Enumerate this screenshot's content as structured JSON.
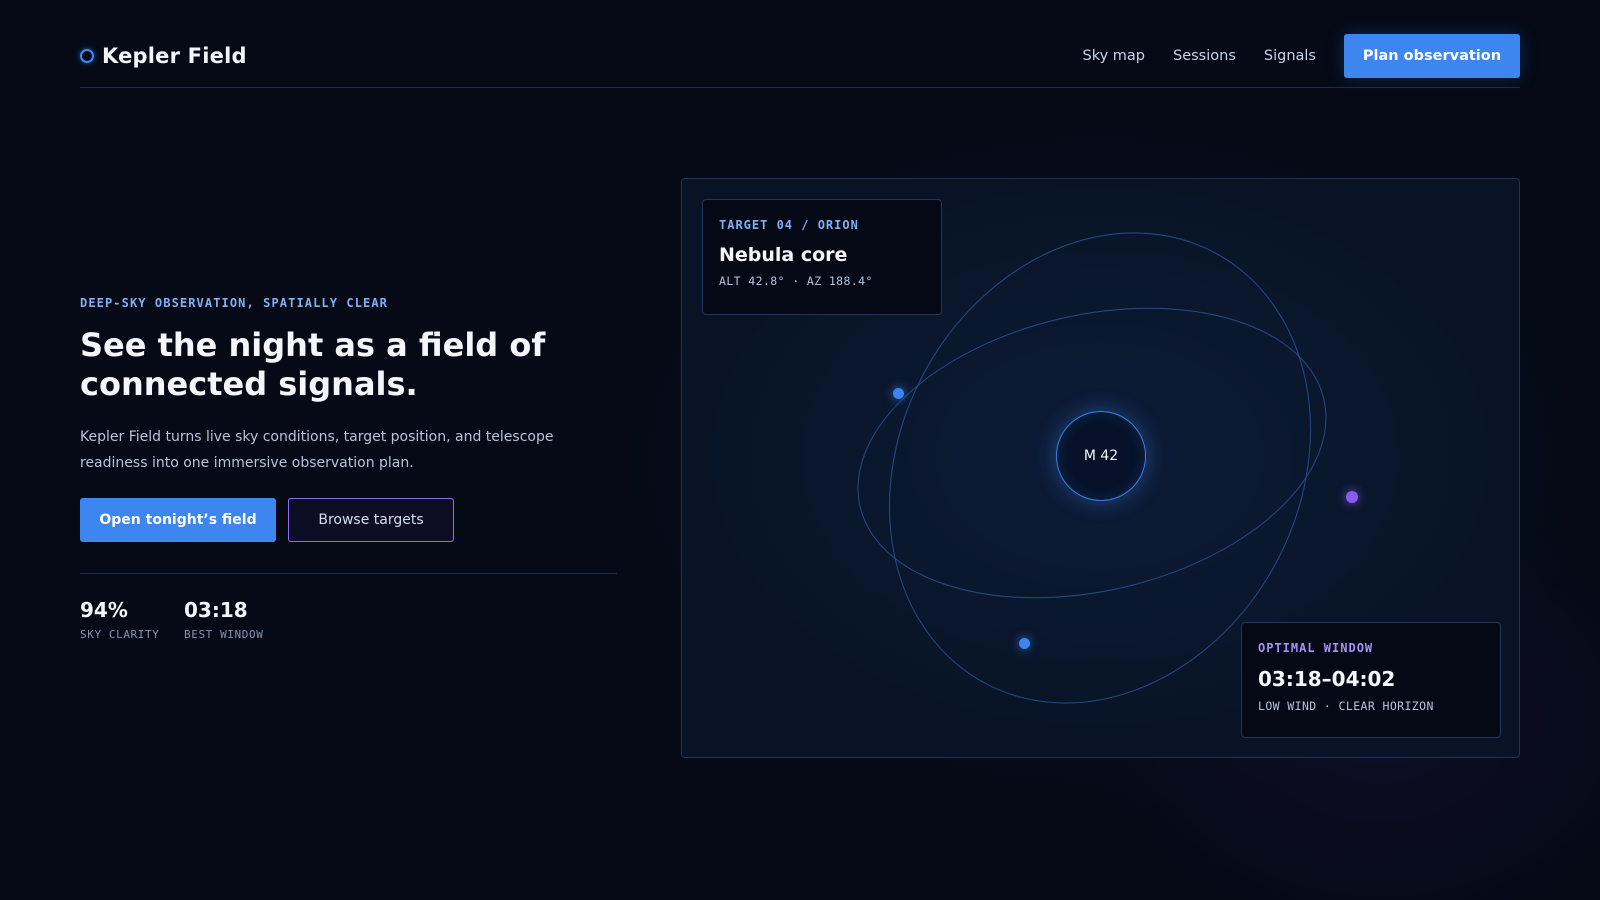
{
  "header": {
    "brand": "Kepler Field",
    "nav": [
      "Sky map",
      "Sessions",
      "Signals"
    ],
    "cta": "Plan observation"
  },
  "hero": {
    "eyebrow": "DEEP-SKY OBSERVATION, SPATIALLY CLEAR",
    "headline": "See the night as a field of connected signals.",
    "lede": "Kepler Field turns live sky conditions, target position, and telescope readiness into one immersive observation plan.",
    "primary_cta": "Open tonight’s field",
    "secondary_cta": "Browse targets",
    "stats": [
      {
        "value": "94%",
        "label": "SKY CLARITY"
      },
      {
        "value": "03:18",
        "label": "BEST WINDOW"
      }
    ]
  },
  "field": {
    "center_label": "M 42",
    "target_card": {
      "eyebrow": "TARGET 04 / ORION",
      "title": "Nebula core",
      "coords": "ALT 42.8° · AZ 188.4°"
    },
    "window_card": {
      "eyebrow": "OPTIMAL WINDOW",
      "time": "03:18–04:02",
      "note": "LOW WIND · CLEAR HORIZON"
    }
  },
  "colors": {
    "background": "#050a16",
    "accent_blue": "#3d85ef",
    "accent_purple": "#8a5cf4",
    "eyebrow_blue": "#7fb0f5",
    "panel_border": "#1e3358"
  },
  "icons": {
    "brand": "orbit-ring-icon"
  }
}
